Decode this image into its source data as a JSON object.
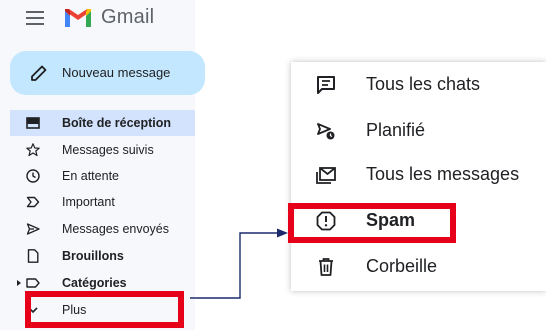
{
  "header": {
    "app_name": "Gmail",
    "menu_icon": "hamburger-menu-icon",
    "logo_icon": "gmail-logo-icon"
  },
  "compose": {
    "label": "Nouveau message",
    "icon": "pencil-icon"
  },
  "sidebar": {
    "items": [
      {
        "label": "Boîte de réception",
        "icon": "inbox-icon",
        "active": true,
        "bold": true
      },
      {
        "label": "Messages suivis",
        "icon": "star-icon"
      },
      {
        "label": "En attente",
        "icon": "clock-icon"
      },
      {
        "label": "Important",
        "icon": "important-icon"
      },
      {
        "label": "Messages envoyés",
        "icon": "send-icon"
      },
      {
        "label": "Brouillons",
        "icon": "draft-icon",
        "bold": true
      },
      {
        "label": "Catégories",
        "icon": "label-icon",
        "bold": true
      },
      {
        "label": "Plus",
        "icon": "chevron-down-icon"
      }
    ]
  },
  "more_menu": {
    "items": [
      {
        "label": "Tous les chats",
        "icon": "chat-icon"
      },
      {
        "label": "Planifié",
        "icon": "scheduled-send-icon"
      },
      {
        "label": "Tous les messages",
        "icon": "all-mail-icon"
      },
      {
        "label": "Spam",
        "icon": "spam-icon",
        "bold": true
      },
      {
        "label": "Corbeille",
        "icon": "trash-icon"
      }
    ]
  },
  "colors": {
    "highlight_red": "#e6001a",
    "compose_bg": "#c2e7ff",
    "active_bg": "#d3e3fd",
    "sidebar_bg": "#f6f8fc",
    "connector": "#1a2a6c"
  }
}
